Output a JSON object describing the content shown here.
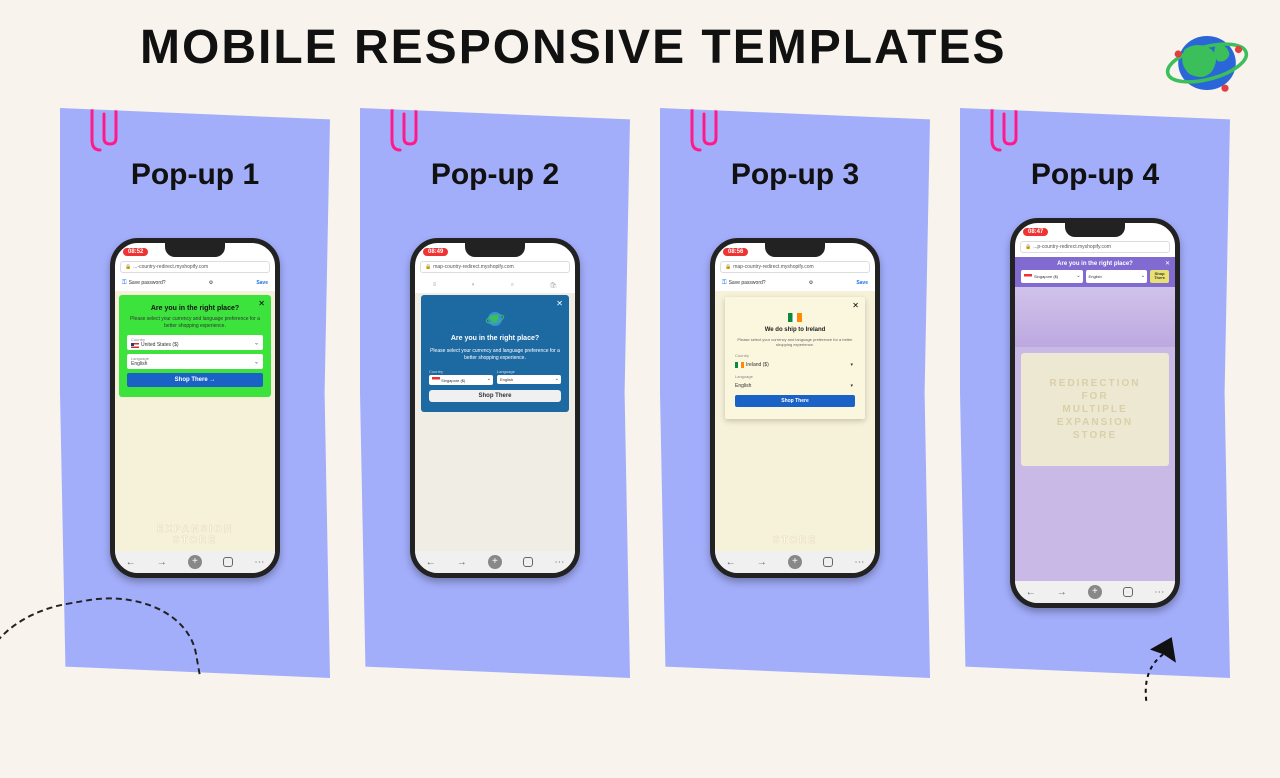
{
  "title": "MOBILE RESPONSIVE TEMPLATES",
  "cards": [
    {
      "label": "Pop-up 1"
    },
    {
      "label": "Pop-up 2"
    },
    {
      "label": "Pop-up 3"
    },
    {
      "label": "Pop-up 4"
    }
  ],
  "phone1": {
    "time": "08:52",
    "url": "...-country-redirect.myshopify.com",
    "save_prompt": "Save password?",
    "save_action": "Save",
    "popup": {
      "heading": "Are you in the right place?",
      "body": "Please select your currency and language preference for a better shopping experience.",
      "country_label": "Country",
      "country_value": "United States ($)",
      "lang_label": "Language",
      "lang_value": "English",
      "button": "Shop There  →"
    },
    "bg_line1": "EXPANSION",
    "bg_line2": "STORE"
  },
  "phone2": {
    "time": "08:49",
    "url": "map-country-redirect.myshopify.com",
    "popup": {
      "heading": "Are you in the right place?",
      "body": "Please select your currency and language preference for a better shopping experience.",
      "country_label": "Country",
      "country_value": "Singapore ($)",
      "lang_label": "Language",
      "lang_value": "English",
      "button": "Shop There"
    }
  },
  "phone3": {
    "time": "08:56",
    "url": "map-country-redirect.myshopify.com",
    "save_prompt": "Save password?",
    "save_action": "Save",
    "popup": {
      "heading": "We do ship to Ireland",
      "body": "Please select your currency and language preference for a better shopping experience.",
      "country_label": "Country",
      "country_value": "Ireland ($)",
      "lang_label": "Language",
      "lang_value": "English",
      "button": "Shop There"
    },
    "bg_line1": "STORE"
  },
  "phone4": {
    "time": "08:47",
    "url": "...p-country-redirect.myshopify.com",
    "bar": {
      "question": "Are you in the right place?",
      "country_value": "Singapore ($)",
      "lang_value": "English",
      "button_l1": "Shop",
      "button_l2": "There"
    },
    "redir_l1": "REDIRECTION",
    "redir_l2": "FOR",
    "redir_l3": "MULTIPLE",
    "redir_l4": "EXPANSION",
    "redir_l5": "STORE"
  }
}
